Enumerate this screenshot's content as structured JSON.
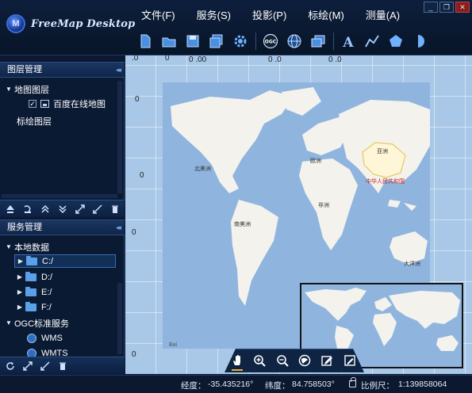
{
  "app": {
    "logo_letter": "M",
    "title": "FreeMap Desktop"
  },
  "menu": [
    "文件(F)",
    "服务(S)",
    "投影(P)",
    "标绘(M)",
    "测量(A)"
  ],
  "window_controls": {
    "minimize": "_",
    "restore": "❐",
    "close": "✕"
  },
  "toolbar": [
    "new-file-icon",
    "open-folder-icon",
    "save-icon",
    "save-all-icon",
    "settings-gear-icon",
    "ogc-service-icon",
    "globe-network-icon",
    "layers-window-icon",
    "text-annotation-icon",
    "polyline-icon",
    "polygon-icon",
    "half-circle-icon"
  ],
  "layer_panel": {
    "title": "图层管理",
    "collapse": "◂◂",
    "tree": [
      {
        "label": "地图图层",
        "expanded": true
      },
      {
        "label": "百度在线地图",
        "checked": true,
        "check_mark": "✓"
      },
      {
        "label": "标绘图层"
      }
    ]
  },
  "service_panel": {
    "title": "服务管理",
    "collapse": "◂◂",
    "tree": [
      {
        "label": "本地数据",
        "expanded": true
      },
      {
        "label": "C:/"
      },
      {
        "label": "D:/"
      },
      {
        "label": "E:/"
      },
      {
        "label": "F:/"
      },
      {
        "label": "OGC标准服务",
        "expanded": true
      },
      {
        "label": "WMS"
      },
      {
        "label": "WMTS"
      }
    ]
  },
  "map": {
    "zero": "0",
    "grid_labels": [
      ".0",
      "0",
      "0",
      "0 .00",
      "0 .0",
      "0 .0",
      "0",
      "0",
      "0",
      "0"
    ],
    "place_labels": {
      "north_america": "北美洲",
      "europe": "欧洲",
      "asia": "亚洲",
      "china": "中华人民共和国",
      "africa": "非洲",
      "south_america": "南美洲",
      "oceania": "大洋洲",
      "attribution": "Bai"
    },
    "colors": {
      "ocean": "#8fb5df",
      "land": "#f4f2ec",
      "highlight": "#e8c860"
    }
  },
  "map_tools": [
    "pan-hand-icon",
    "zoom-in-icon",
    "zoom-out-icon",
    "full-extent-icon",
    "edit-icon",
    "edit-box-icon"
  ],
  "status_bar": {
    "lon_label": "经度：",
    "lon_value": "-35.435216°",
    "lat_label": "纬度：",
    "lat_value": "84.758503°",
    "scale_label": "比例尺：",
    "scale_value": "1:139858064"
  }
}
